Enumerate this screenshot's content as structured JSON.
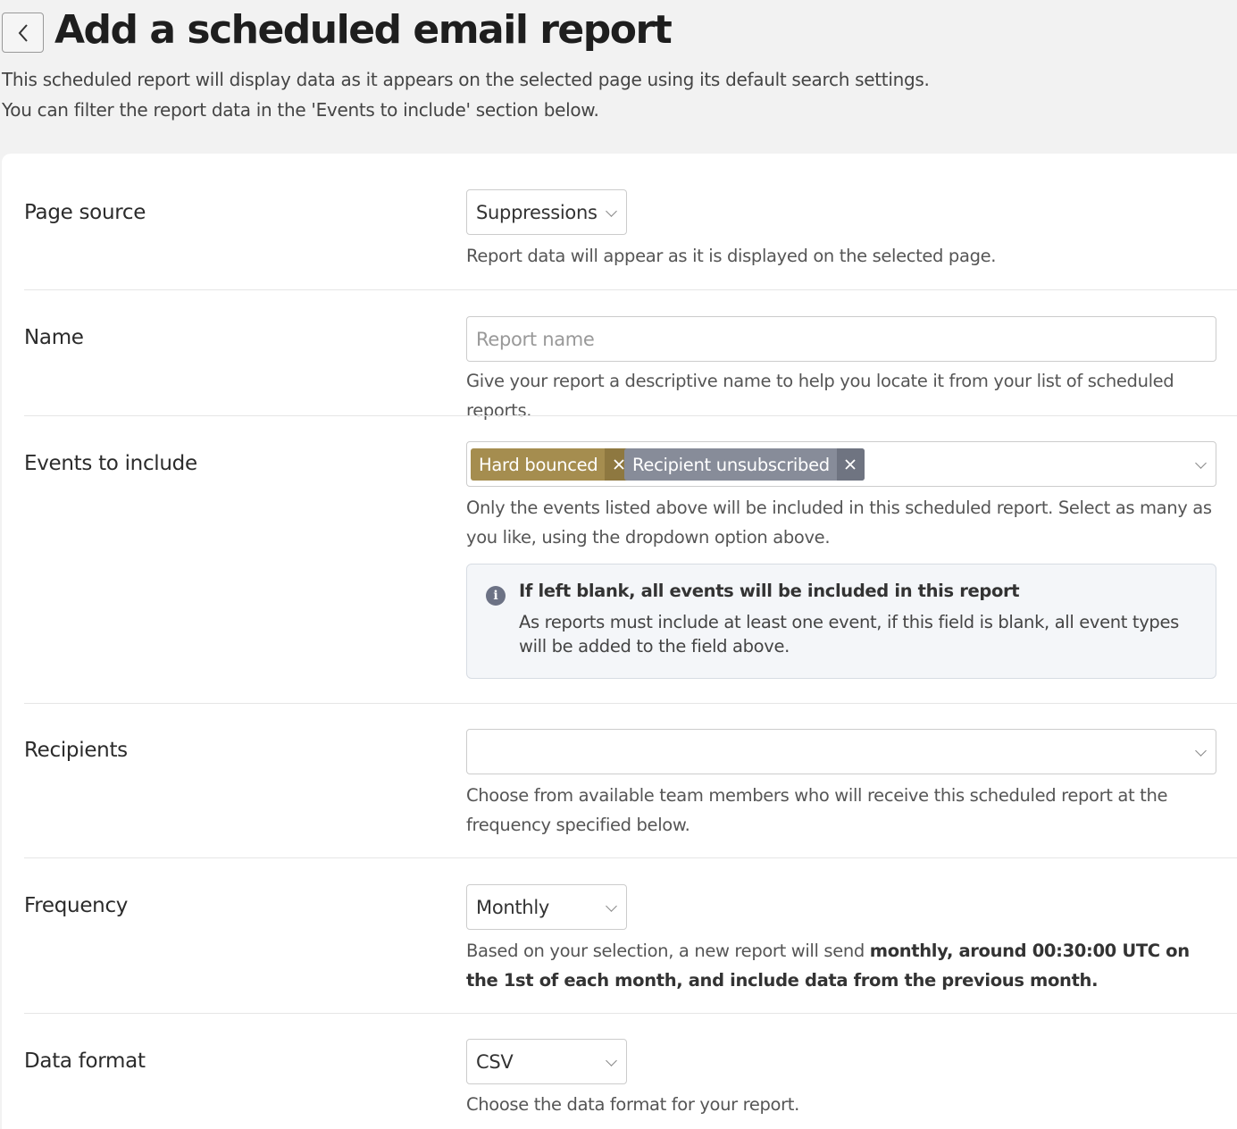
{
  "header": {
    "title": "Add a scheduled email report",
    "intro_line1": "This scheduled report will display data as it appears on the selected page using its default search settings.",
    "intro_line2": "You can filter the report data in the 'Events to include' section below."
  },
  "form": {
    "page_source": {
      "label": "Page source",
      "value": "Suppressions",
      "help": "Report data will appear as it is displayed on the selected page."
    },
    "name": {
      "label": "Name",
      "value": "",
      "placeholder": "Report name",
      "help": "Give your report a descriptive name to help you locate it from your list of scheduled reports."
    },
    "events": {
      "label": "Events to include",
      "tags": [
        {
          "label": "Hard bounced",
          "color": "#a58d4f"
        },
        {
          "label": "Recipient unsubscribed",
          "color": "#878c99"
        }
      ],
      "help": "Only the events listed above will be included in this scheduled report. Select as many as you like, using the dropdown option above.",
      "info_title": "If left blank, all events will be included in this report",
      "info_body": "As reports must include at least one event, if this field is blank, all event types will be added to the field above."
    },
    "recipients": {
      "label": "Recipients",
      "value": "",
      "help": "Choose from available team members who will receive this scheduled report at the frequency specified below."
    },
    "frequency": {
      "label": "Frequency",
      "value": "Monthly",
      "help_prefix": "Based on your selection, a new report will send ",
      "help_bold": "monthly, around 00:30:00 UTC on the 1st of each month, and include data from the previous month."
    },
    "data_format": {
      "label": "Data format",
      "value": "CSV",
      "help": "Choose the data format for your report."
    }
  }
}
